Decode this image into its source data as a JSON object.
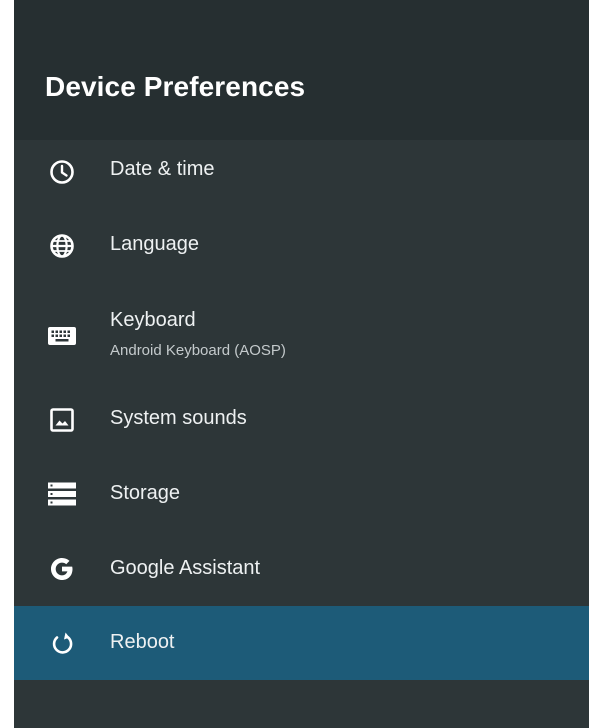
{
  "header": {
    "title": "Device Preferences"
  },
  "menu": {
    "items": [
      {
        "label": "Date & time",
        "icon": "clock-icon"
      },
      {
        "label": "Language",
        "icon": "globe-icon"
      },
      {
        "label": "Keyboard",
        "sublabel": "Android Keyboard (AOSP)",
        "icon": "keyboard-icon"
      },
      {
        "label": "System sounds",
        "icon": "image-icon"
      },
      {
        "label": "Storage",
        "icon": "storage-icon"
      },
      {
        "label": "Google Assistant",
        "icon": "google-g-icon"
      },
      {
        "label": "Reboot",
        "icon": "reboot-icon",
        "selected": true
      }
    ]
  },
  "colors": {
    "panel_background": "#2d3638",
    "header_background": "#262f31",
    "selection_highlight": "#1d5b78",
    "text_primary": "#eef1f2",
    "text_secondary": "#c4cacc"
  }
}
